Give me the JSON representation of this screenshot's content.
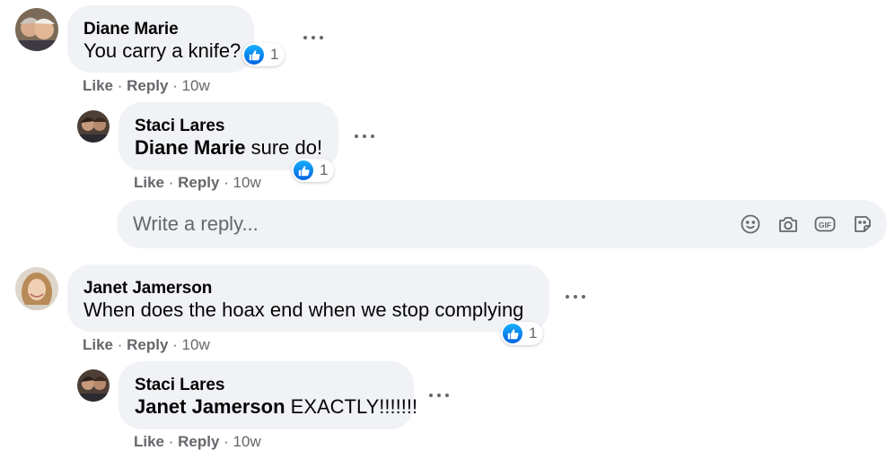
{
  "comments": [
    {
      "author": "Diane Marie",
      "text": "You carry a knife?",
      "reaction_count": "1",
      "actions": {
        "like": "Like",
        "reply": "Reply",
        "time": "10w"
      },
      "replies": [
        {
          "author": "Staci Lares",
          "mention": "Diane Marie",
          "text": " sure do!",
          "reaction_count": "1",
          "actions": {
            "like": "Like",
            "reply": "Reply",
            "time": "10w"
          }
        }
      ]
    },
    {
      "author": "Janet Jamerson",
      "text": "When does the hoax end when we stop complying",
      "reaction_count": "1",
      "actions": {
        "like": "Like",
        "reply": "Reply",
        "time": "10w"
      },
      "replies": [
        {
          "author": "Staci Lares",
          "mention": "Janet Jamerson",
          "text": " EXACTLY!!!!!!!",
          "actions": {
            "like": "Like",
            "reply": "Reply",
            "time": "10w"
          }
        }
      ]
    }
  ],
  "reply_box": {
    "placeholder": "Write a reply...",
    "icons": [
      "emoji-icon",
      "camera-icon",
      "gif-icon",
      "sticker-icon"
    ]
  },
  "colors": {
    "bubble": "#f0f2f5",
    "secondary_text": "#65676b",
    "like_blue": "#0866ff"
  },
  "separator": " · "
}
